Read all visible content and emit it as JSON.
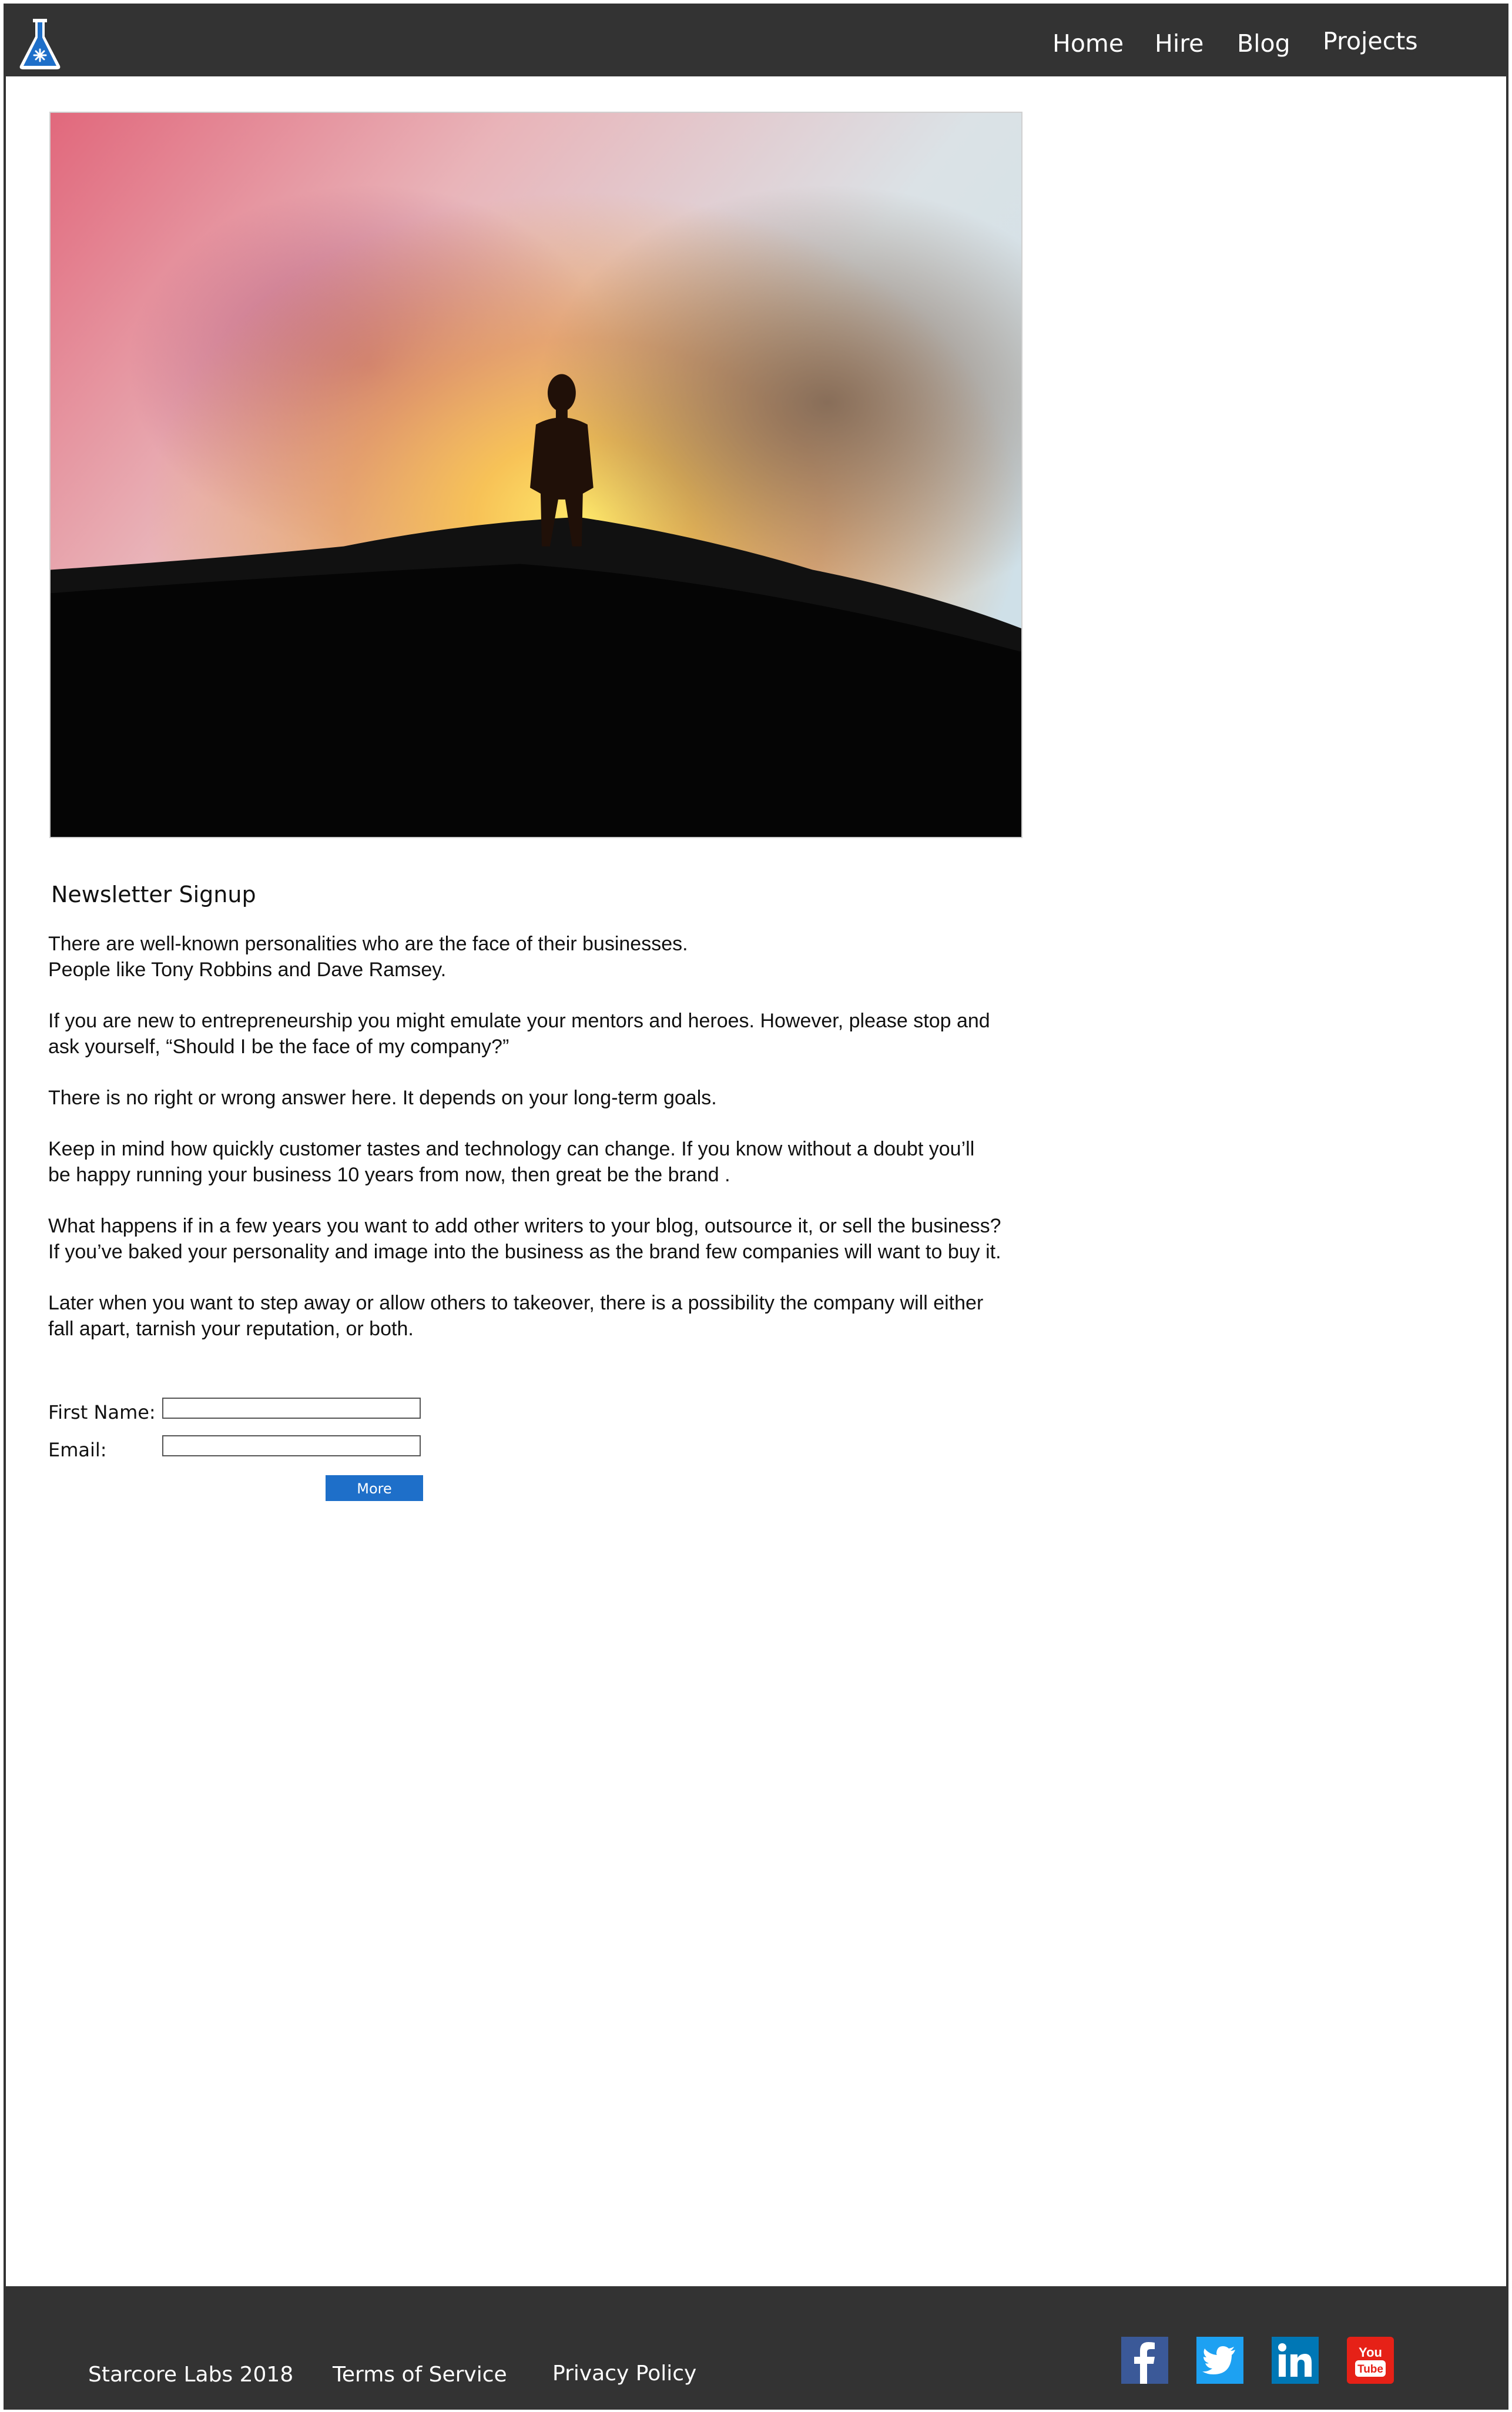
{
  "nav": {
    "items": [
      {
        "label": "Home"
      },
      {
        "label": "Hire"
      },
      {
        "label": "Blog"
      },
      {
        "label": "Projects"
      }
    ]
  },
  "main": {
    "section_title": "Newsletter Signup",
    "paragraphs": [
      [
        "There are well-known personalities who are the face of their businesses.",
        "People like Tony Robbins and Dave Ramsey."
      ],
      [
        "If you are new to entrepreneurship you might emulate your mentors and heroes. However,  please stop and",
        "ask yourself, “Should I be the face of my company?”"
      ],
      [
        "There is no right or wrong answer here. It depends on your long-term goals."
      ],
      [
        "Keep in mind how quickly customer tastes and technology can change. If you know without a doubt you’ll",
        "be happy running your business 10 years from now, then great be the brand ."
      ],
      [
        "What happens if in a few years you want to add other writers to your blog, outsource it, or sell the business?",
        "If you’ve baked your personality and image into the business as the brand few companies will want to buy it."
      ],
      [
        "Later when you want to step away or allow others to takeover, there is a possibility the company will either",
        "fall apart, tarnish your reputation, or both."
      ]
    ]
  },
  "form": {
    "first_name_label": "First Name:",
    "first_name_value": "",
    "email_label": "Email:",
    "email_value": "",
    "submit_label": "More"
  },
  "footer": {
    "copyright": "Starcore Labs 2018",
    "terms": "Terms of Service",
    "privacy": "Privacy Policy",
    "youtube_icon_text_top": "You",
    "youtube_icon_text_bottom": "Tube"
  },
  "colors": {
    "header_bg": "#333333",
    "button_blue": "#1e6fc9",
    "facebook": "#3b5998",
    "twitter": "#1da1f2",
    "linkedin": "#0077b5",
    "youtube": "#e62117"
  },
  "icons": {
    "logo": "flask-logo-icon",
    "social": [
      "facebook-icon",
      "twitter-icon",
      "linkedin-icon",
      "youtube-icon"
    ]
  }
}
